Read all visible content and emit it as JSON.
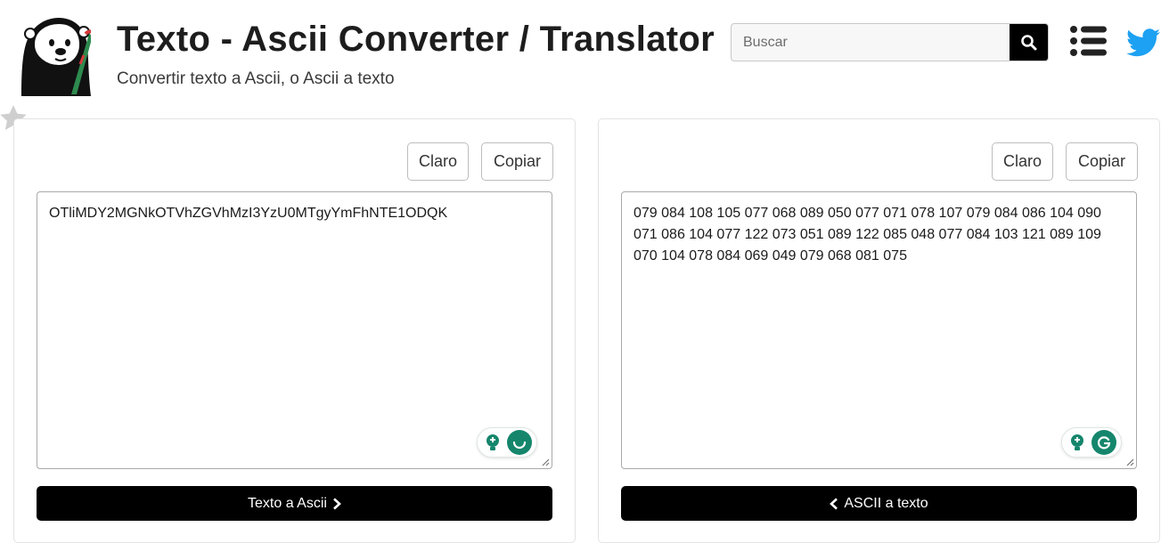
{
  "header": {
    "title": "Texto - Ascii Converter / Translator",
    "subtitle": "Convertir texto a Ascii, o Ascii a texto"
  },
  "search": {
    "placeholder": "Buscar",
    "value": ""
  },
  "left_panel": {
    "clear_label": "Claro",
    "copy_label": "Copiar",
    "text": "OTliMDY2MGNkOTVhZGVhMzI3YzU0MTgyYmFhNTE1ODQK",
    "action_label": "Texto a Ascii"
  },
  "right_panel": {
    "clear_label": "Claro",
    "copy_label": "Copiar",
    "text": "079 084 108 105 077 068 089 050 077 071 078 107 079 084 086 104 090 071 086 104 077 122 073 051 089 122 085 048 077 084 103 121 089 109 070 104 078 084 069 049 079 068 081 075",
    "action_label": "ASCII a texto"
  },
  "colors": {
    "button_dark": "#000000",
    "grammarly_green": "#15866c",
    "twitter_blue": "#1da1f2"
  },
  "icons": [
    "otter-logo",
    "search-icon",
    "list-icon",
    "twitter-icon",
    "star-icon",
    "chevron-right-icon",
    "chevron-left-icon",
    "grammarly-icon",
    "lightbulb-icon"
  ]
}
